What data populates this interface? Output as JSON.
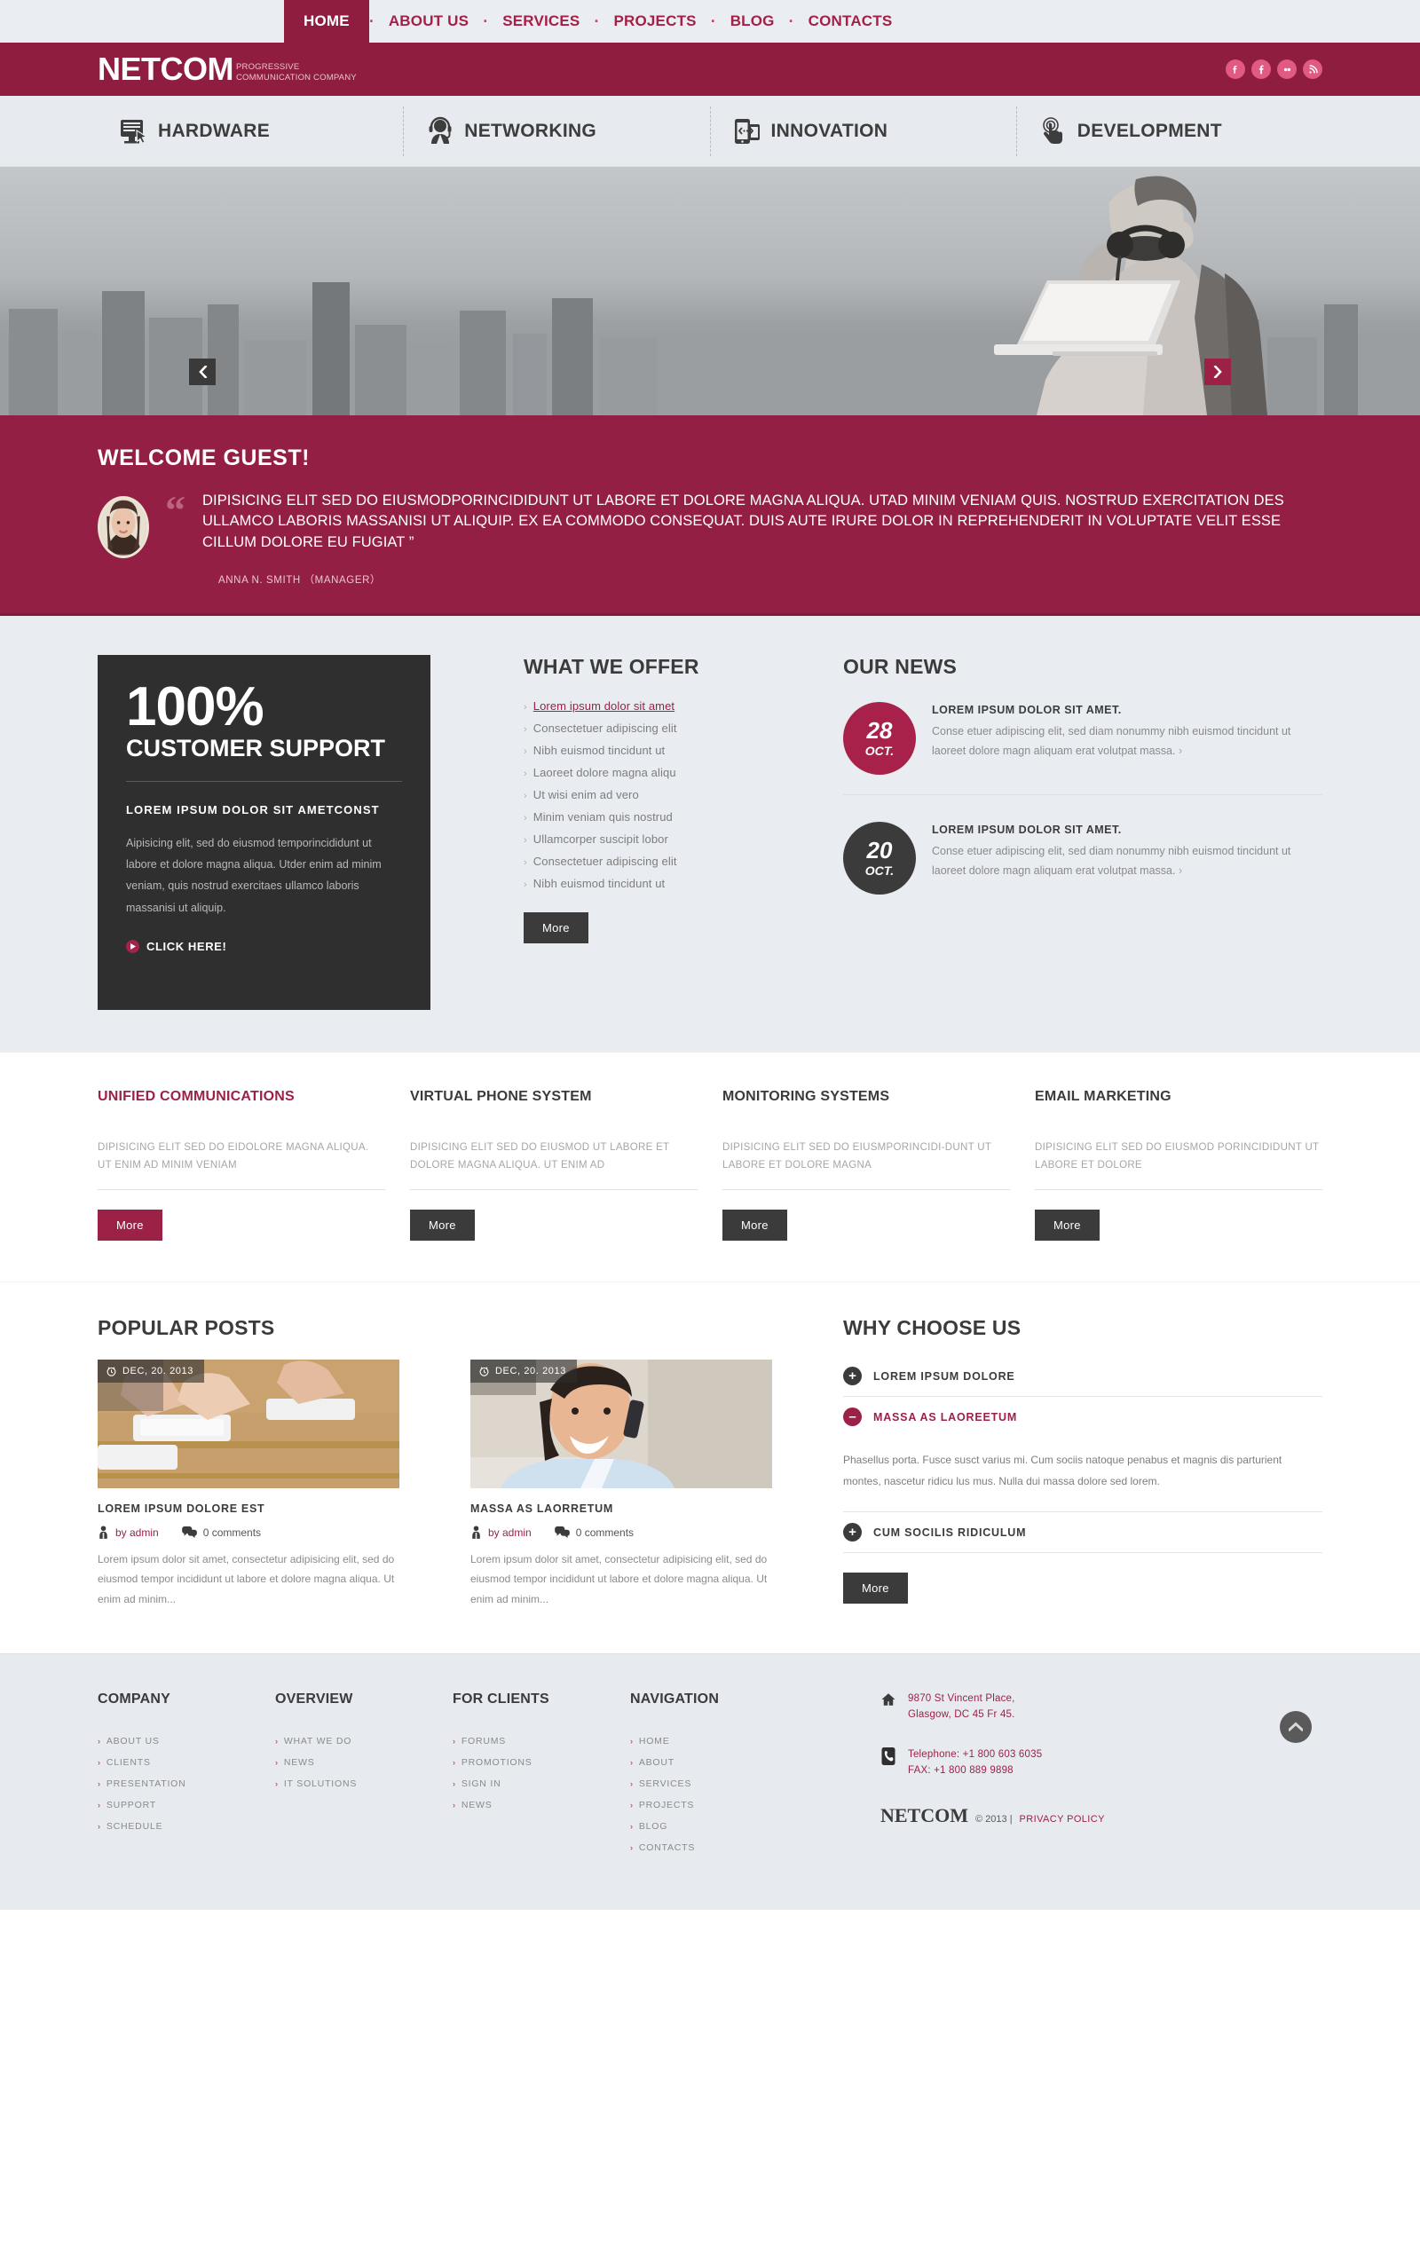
{
  "topnav": {
    "items": [
      {
        "label": "HOME",
        "active": true
      },
      {
        "label": "ABOUT US",
        "active": false
      },
      {
        "label": "SERVICES",
        "active": false
      },
      {
        "label": "PROJECTS",
        "active": false
      },
      {
        "label": "BLOG",
        "active": false
      },
      {
        "label": "CONTACTS",
        "active": false
      }
    ]
  },
  "header": {
    "logo": "NETCOM",
    "tagline_line1": "PROGRESSIVE",
    "tagline_line2": "COMMUNICATION COMPANY",
    "socials": [
      "twitter-icon",
      "facebook-icon",
      "flickr-icon",
      "rss-icon"
    ],
    "brand_color": "#8e1d3f",
    "accent_color": "#9b2246"
  },
  "strip": {
    "items": [
      {
        "label": "HARDWARE",
        "icon": "monitor-cursor-icon"
      },
      {
        "label": "NETWORKING",
        "icon": "headset-support-icon"
      },
      {
        "label": "INNOVATION",
        "icon": "mobile-devices-icon"
      },
      {
        "label": "DEVELOPMENT",
        "icon": "hand-tap-icon"
      }
    ]
  },
  "hero": {
    "prev_label": "‹",
    "next_label": "›"
  },
  "welcome": {
    "title": "WELCOME GUEST!",
    "quote": "DIPISICING ELIT SED DO EIUSMODPORINCIDIDUNT UT LABORE ET DOLORE MAGNA ALIQUA. UTAD MINIM VENIAM QUIS. NOSTRUD EXERCITATION DES ULLAMCO LABORIS MASSANISI UT ALIQUIP. EX EA COMMODO CONSEQUAT. DUIS AUTE IRURE DOLOR IN REPREHENDERIT IN VOLUPTATE VELIT ESSE CILLUM DOLORE EU FUGIAT ”",
    "author": "ANNA N. SMITH （MANAGER）"
  },
  "support": {
    "percent": "100%",
    "subtitle": "CUSTOMER SUPPORT",
    "heading": "LOREM IPSUM DOLOR SIT AMETCONST",
    "body": "Aipisicing elit, sed do eiusmod temporincididunt ut labore et dolore magna aliqua. Utder enim ad minim veniam, quis nostrud exercitaes ullamco laboris massanisi ut aliquip.",
    "cta": "CLICK HERE!"
  },
  "offer": {
    "title": "WHAT WE OFFER",
    "items": [
      {
        "label": "Lorem ipsum dolor sit amet",
        "active": true
      },
      {
        "label": "Consectetuer adipiscing elit",
        "active": false
      },
      {
        "label": "Nibh euismod tincidunt ut",
        "active": false
      },
      {
        "label": "Laoreet dolore magna aliqu",
        "active": false
      },
      {
        "label": "Ut wisi enim ad vero",
        "active": false
      },
      {
        "label": "Minim veniam quis nostrud",
        "active": false
      },
      {
        "label": "Ullamcorper suscipit lobor",
        "active": false
      },
      {
        "label": "Consectetuer adipiscing elit",
        "active": false
      },
      {
        "label": "Nibh euismod tincidunt ut",
        "active": false
      }
    ],
    "more_label": "More"
  },
  "news": {
    "title": "OUR NEWS",
    "items": [
      {
        "day": "28",
        "month": "OCT.",
        "style": "red",
        "title": "LOREM IPSUM DOLOR SIT AMET.",
        "text": "Conse etuer adipiscing elit, sed diam nonummy nibh euismod tincidunt ut laoreet dolore magn aliquam erat volutpat massa."
      },
      {
        "day": "20",
        "month": "OCT.",
        "style": "dark",
        "title": "LOREM IPSUM DOLOR SIT AMET.",
        "text": "Conse etuer adipiscing elit, sed diam nonummy nibh euismod tincidunt ut laoreet dolore magn aliquam erat volutpat massa."
      }
    ]
  },
  "services": {
    "items": [
      {
        "title": "UNIFIED COMMUNICATIONS",
        "text": "DIPISICING ELIT SED DO EIDOLORE MAGNA ALIQUA. UT ENIM AD MINIM VENIAM",
        "button": "More",
        "highlight": true
      },
      {
        "title": "VIRTUAL PHONE SYSTEM",
        "text": "DIPISICING ELIT SED DO EIUSMOD UT LABORE ET DOLORE MAGNA ALIQUA. UT ENIM AD",
        "button": "More",
        "highlight": false
      },
      {
        "title": "MONITORING SYSTEMS",
        "text": "DIPISICING ELIT SED DO EIUSMPORINCIDI-DUNT UT LABORE ET DOLORE MAGNA",
        "button": "More",
        "highlight": false
      },
      {
        "title": "EMAIL MARKETING",
        "text": "DIPISICING ELIT SED DO EIUSMOD PORINCIDIDUNT UT LABORE ET DOLORE",
        "button": "More",
        "highlight": false
      }
    ]
  },
  "posts": {
    "title": "POPULAR POSTS",
    "items": [
      {
        "date": "DEC, 20. 2013",
        "title": "LOREM IPSUM DOLORE EST",
        "author": "by admin",
        "comments": "0 comments",
        "excerpt": "Lorem ipsum dolor sit amet, consectetur adipisicing elit, sed do eiusmod tempor incididunt ut labore et dolore magna aliqua. Ut enim ad minim..."
      },
      {
        "date": "DEC, 20. 2013",
        "title": "MASSA AS LAORRETUM",
        "author": "by admin",
        "comments": "0 comments",
        "excerpt": "Lorem ipsum dolor sit amet, consectetur adipisicing elit, sed do eiusmod tempor incididunt ut labore et dolore magna aliqua. Ut enim ad minim..."
      }
    ]
  },
  "why": {
    "title": "WHY CHOOSE US",
    "items": [
      {
        "label": "LOREM IPSUM DOLORE",
        "open": false,
        "sign": "+"
      },
      {
        "label": "MASSA AS LAOREETUM",
        "open": true,
        "sign": "–",
        "body": "Phasellus porta. Fusce susct varius mi. Cum sociis natoque penabus et magnis dis parturient montes, nascetur ridicu lus mus. Nulla dui massa dolore sed lorem."
      },
      {
        "label": "CUM SOCILIS RIDICULUM",
        "open": false,
        "sign": "+"
      }
    ],
    "more_label": "More"
  },
  "footer": {
    "columns": [
      {
        "title": "COMPANY",
        "links": [
          "ABOUT US",
          "CLIENTS",
          "PRESENTATION",
          "SUPPORT",
          "SCHEDULE"
        ]
      },
      {
        "title": "OVERVIEW",
        "links": [
          "WHAT WE DO",
          "NEWS",
          "IT SOLUTIONS"
        ]
      },
      {
        "title": "FOR CLIENTS",
        "links": [
          "FORUMS",
          "PROMOTIONS",
          "SIGN IN",
          "NEWS"
        ]
      },
      {
        "title": "NAVIGATION",
        "links": [
          "HOME",
          "ABOUT",
          "SERVICES",
          "PROJECTS",
          "BLOG",
          "CONTACTS"
        ]
      }
    ],
    "address_line1": "9870 St Vincent Place,",
    "address_line2": "Glasgow, DC 45 Fr 45.",
    "phone_line1": "Telephone: +1 800 603 6035",
    "phone_line2": "FAX: +1 800 889 9898",
    "copy_logo": "NETCOM",
    "copy_text": "© 2013 |",
    "copy_link": "PRIVACY POLICY"
  }
}
